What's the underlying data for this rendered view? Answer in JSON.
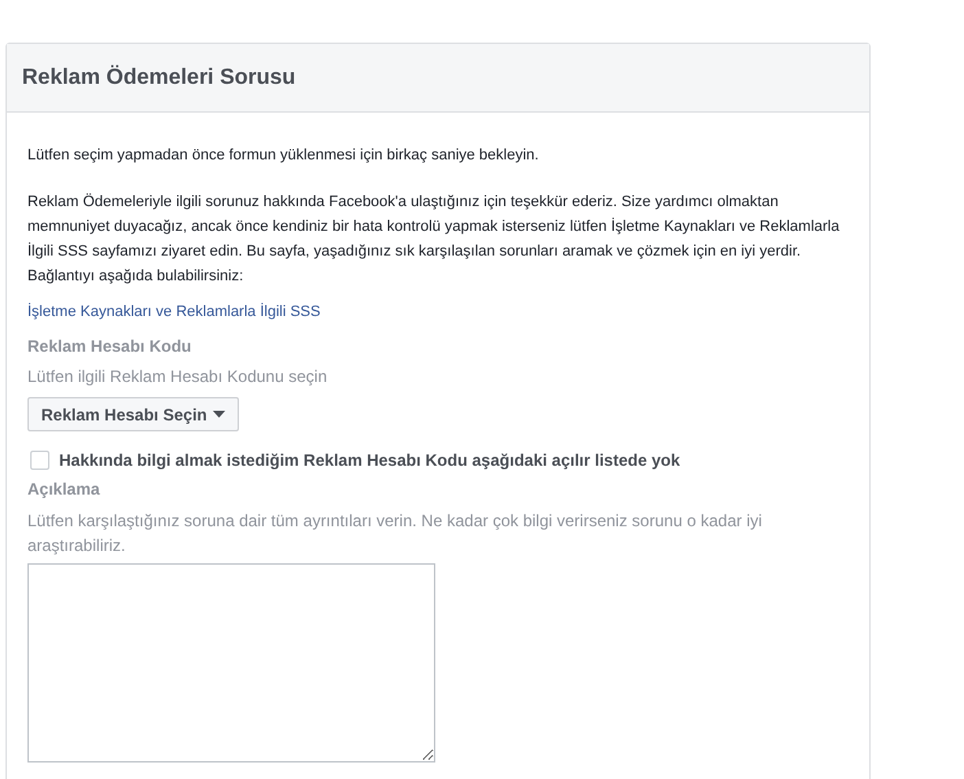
{
  "card": {
    "title": "Reklam Ödemeleri Sorusu"
  },
  "intro": "Lütfen seçim yapmadan önce formun yüklenmesi için birkaç saniye bekleyin.",
  "paragraph": "Reklam Ödemeleriyle ilgili sorunuz hakkında Facebook'a ulaştığınız için teşekkür ederiz. Size yardımcı olmaktan memnuniyet duyacağız, ancak önce kendiniz bir hata kontrolü yapmak isterseniz lütfen İşletme Kaynakları ve Reklamlarla İlgili SSS sayfamızı ziyaret edin. Bu sayfa, yaşadığınız sık karşılaşılan sorunları aramak ve çözmek için en iyi yerdir. Bağlantıyı aşağıda bulabilirsiniz:",
  "link": "İşletme Kaynakları ve Reklamlarla İlgili SSS",
  "account": {
    "label": "Reklam Hesabı Kodu",
    "hint": "Lütfen ilgili Reklam Hesabı Kodunu seçin",
    "dropdown": "Reklam Hesabı Seçin"
  },
  "not_listed": {
    "label": "Hakkında bilgi almak istediğim Reklam Hesabı Kodu aşağıdaki açılır listede yok",
    "checked": false
  },
  "description": {
    "label": "Açıklama",
    "hint": "Lütfen karşılaştığınız soruna dair tüm ayrıntıları verin. Ne kadar çok bilgi verirseniz sorunu o kadar iyi araştırabiliriz."
  }
}
